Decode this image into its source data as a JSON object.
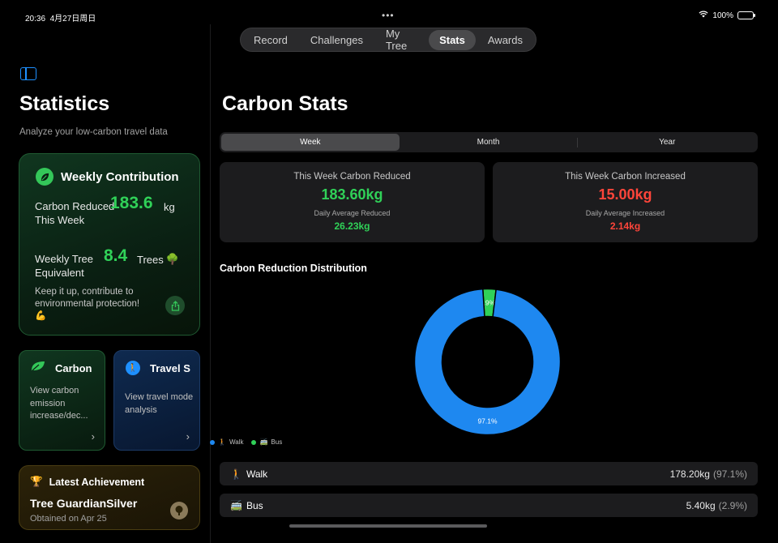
{
  "status": {
    "time": "20:36",
    "date": "4月27日周日",
    "battery": "100%"
  },
  "tabs": [
    {
      "label": "Record"
    },
    {
      "label": "Challenges"
    },
    {
      "label": "My Tree"
    },
    {
      "label": "Stats"
    },
    {
      "label": "Awards"
    }
  ],
  "active_tab": "Stats",
  "sidebar": {
    "title": "Statistics",
    "subtitle": "Analyze your low-carbon travel data",
    "weekly": {
      "title": "Weekly Contribution",
      "reduced_label": "Carbon Reduced This Week",
      "reduced_value": "183.6",
      "reduced_unit": "kg",
      "tree_label": "Weekly Tree Equivalent",
      "tree_value": "8.4",
      "tree_unit": "Trees",
      "tree_emoji": "🌳",
      "encourage": "Keep it up, contribute to environmental protection!",
      "encourage_emoji": "💪"
    },
    "carbon_card": {
      "title": "Carbon",
      "desc": "View carbon emission increase/dec..."
    },
    "travel_card": {
      "title": "Travel S",
      "desc": "View travel mode analysis"
    },
    "achievement": {
      "header": "Latest Achievement",
      "name": "Tree GuardianSilver",
      "date": "Obtained on Apr 25"
    }
  },
  "main": {
    "title": "Carbon Stats",
    "periods": [
      {
        "label": "Week"
      },
      {
        "label": "Month"
      },
      {
        "label": "Year"
      }
    ],
    "active_period": "Week",
    "reduced": {
      "label": "This Week Carbon Reduced",
      "value": "183.60kg",
      "sub_label": "Daily Average Reduced",
      "sub_value": "26.23kg"
    },
    "increased": {
      "label": "This Week Carbon Increased",
      "value": "15.00kg",
      "sub_label": "Daily Average Increased",
      "sub_value": "2.14kg"
    },
    "distribution_title": "Carbon Reduction Distribution",
    "legend": [
      {
        "emoji": "🚶",
        "label": "Walk",
        "color": "#1e88f0"
      },
      {
        "emoji": "🚎",
        "label": "Bus",
        "color": "#30d158"
      }
    ],
    "rows": [
      {
        "emoji": "🚶",
        "label": "Walk",
        "value": "178.20kg",
        "pct": "(97.1%)"
      },
      {
        "emoji": "🚎",
        "label": "Bus",
        "value": "5.40kg",
        "pct": "(2.9%)"
      }
    ]
  },
  "chart_data": {
    "type": "pie",
    "title": "Carbon Reduction Distribution",
    "categories": [
      "Walk",
      "Bus"
    ],
    "values": [
      97.1,
      2.9
    ],
    "labels": [
      "97.1%",
      "2.9%"
    ],
    "colors": [
      "#1e88f0",
      "#30d158"
    ],
    "donut": true
  }
}
